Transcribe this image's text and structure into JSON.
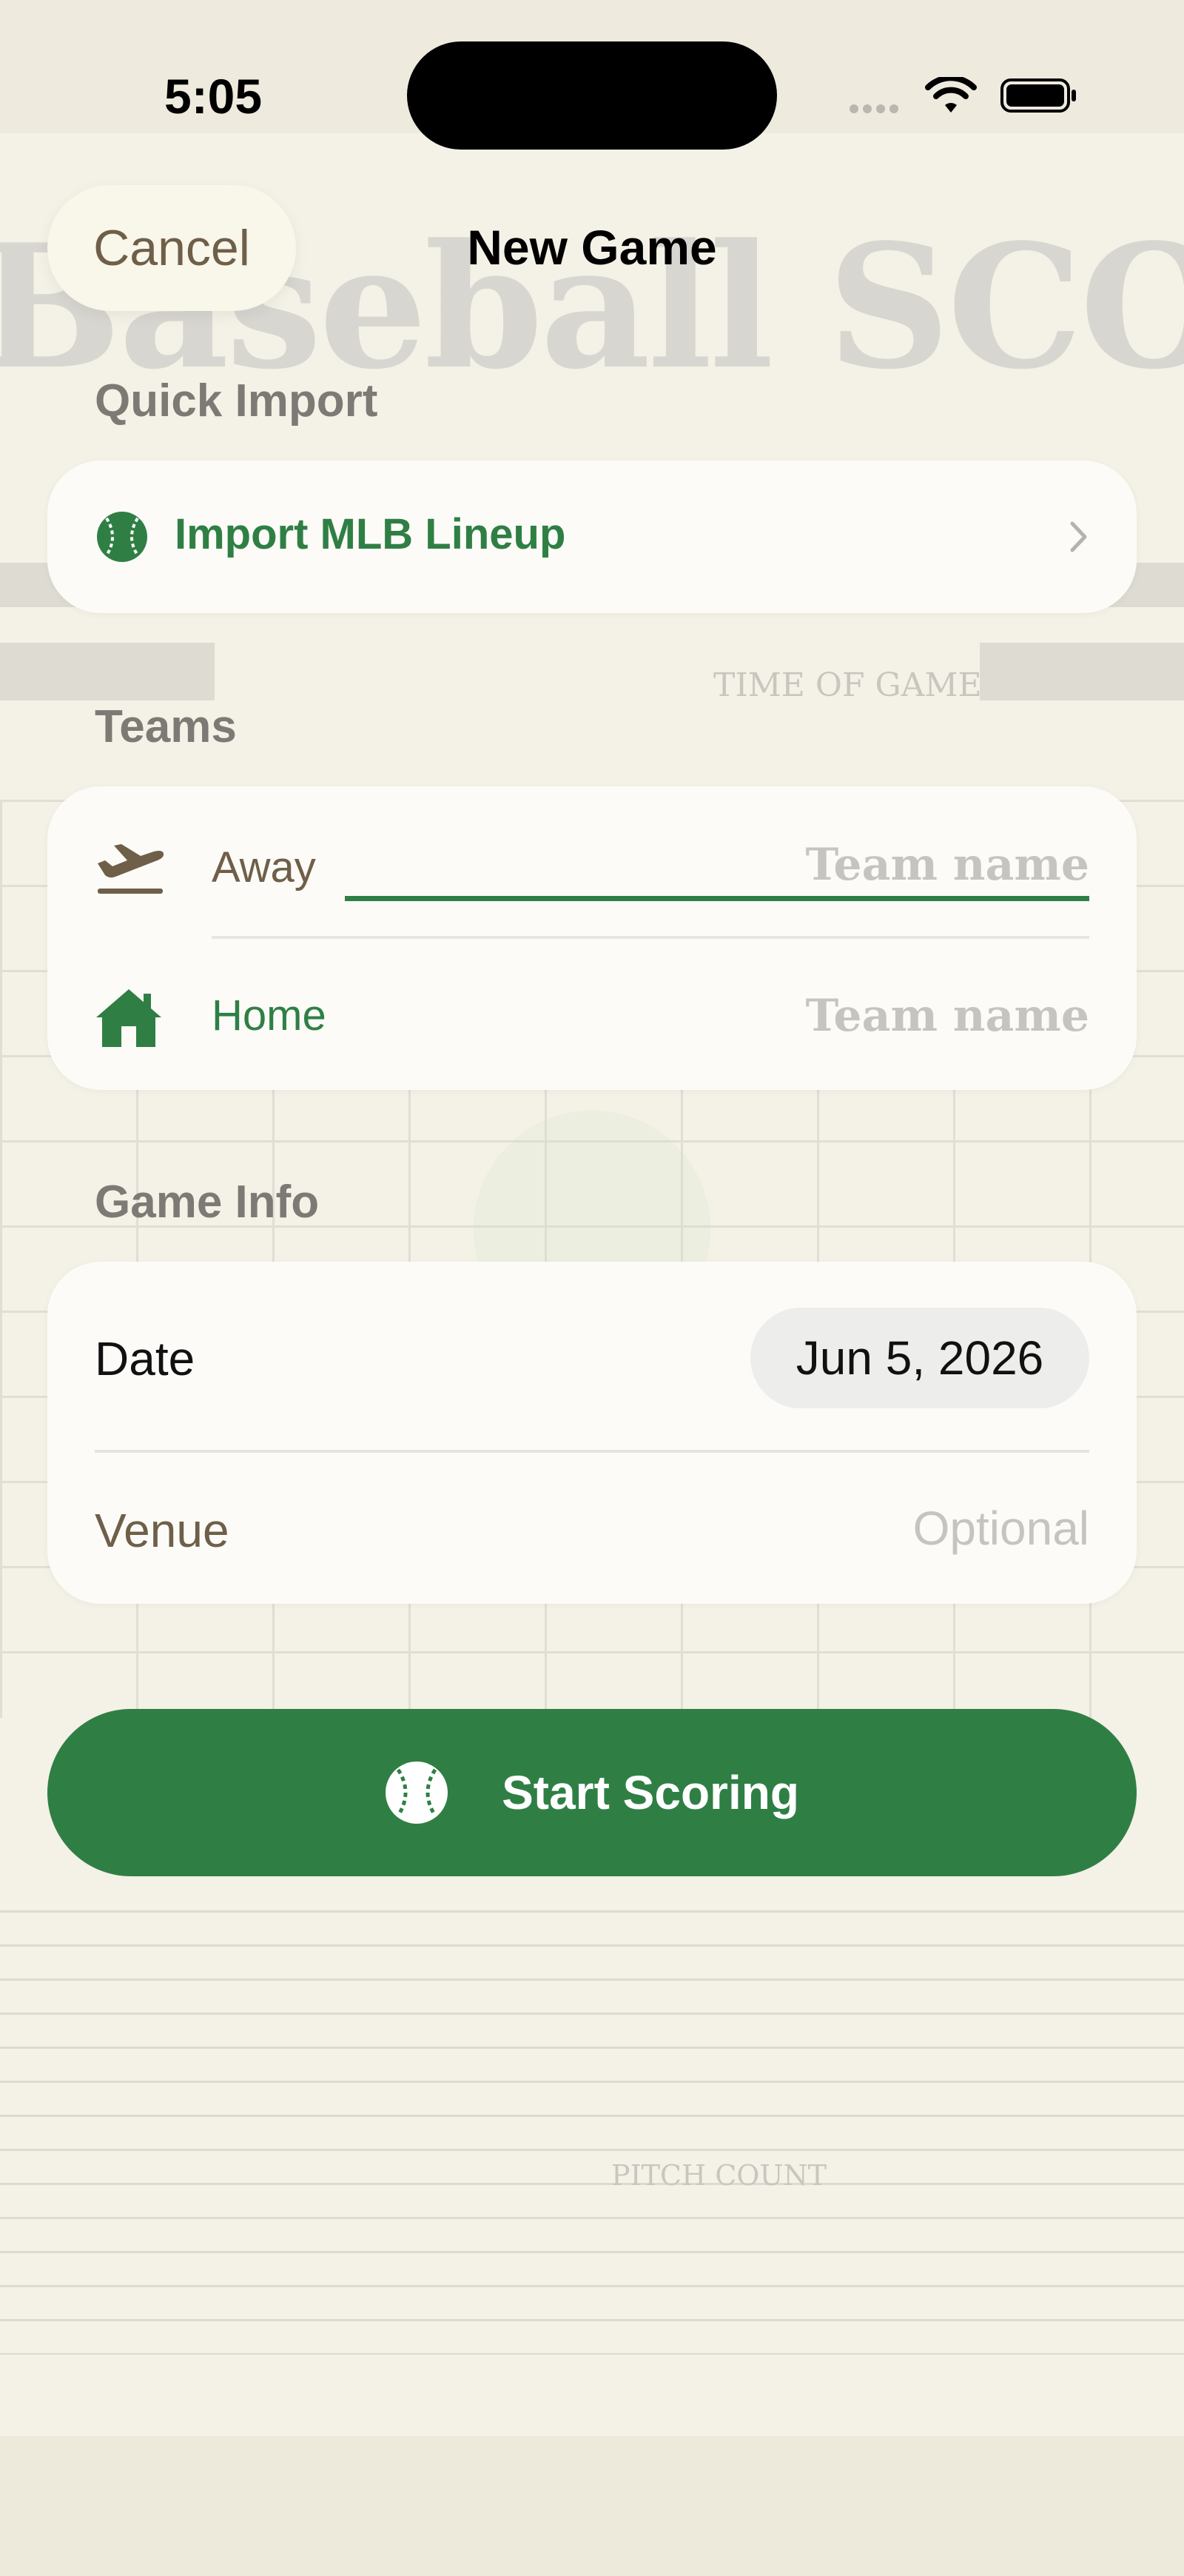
{
  "status_bar": {
    "time": "5:05"
  },
  "nav": {
    "cancel_label": "Cancel",
    "title": "New Game"
  },
  "quick_import": {
    "section_title": "Quick Import",
    "import_label": "Import MLB Lineup",
    "icon": "baseball-icon"
  },
  "teams": {
    "section_title": "Teams",
    "away": {
      "label": "Away",
      "placeholder": "Team name",
      "value": "",
      "icon": "airplane-departure-icon"
    },
    "home": {
      "label": "Home",
      "placeholder": "Team name",
      "value": "",
      "icon": "house-icon"
    }
  },
  "game_info": {
    "section_title": "Game Info",
    "date_label": "Date",
    "date_value": "Jun 5, 2026",
    "venue_label": "Venue",
    "venue_placeholder": "Optional"
  },
  "start_button": {
    "label": "Start Scoring",
    "icon": "baseball-icon"
  },
  "background": {
    "scorebook_title": "Baseball SCOREBOOK",
    "time_of_game_label": "TIME OF GAME",
    "pitch_count_label": "PITCH COUNT"
  },
  "colors": {
    "accent_green": "#2f7f45",
    "brown_text": "#6f5f49",
    "background": "#f4f1e6",
    "card": "#fcfbf7"
  }
}
